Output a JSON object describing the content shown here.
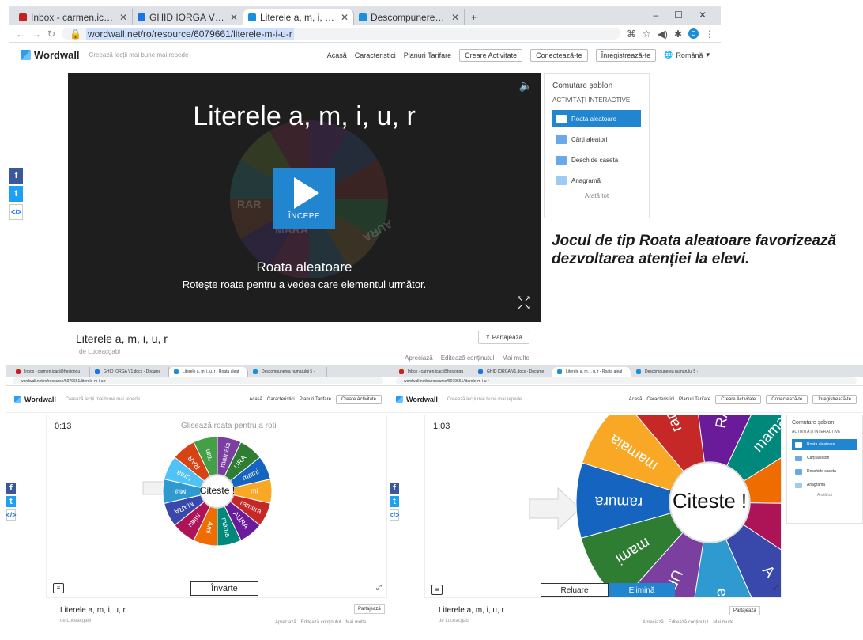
{
  "top": {
    "tabs": [
      {
        "title": "Inbox - carmen.icaci@hesiongu",
        "color": "#c5221f"
      },
      {
        "title": "GHID IORGA V1.docx - Docume",
        "color": "#1a73e8"
      },
      {
        "title": "Literele a, m, i, u, r - Roata aleat",
        "color": "#1a8fe0"
      },
      {
        "title": "Descompunerea numarului 5 - ",
        "color": "#1a8fe0"
      }
    ],
    "new_tab": "+",
    "url": "wordwall.net/ro/resource/6079661/literele-m-i-u-r",
    "logo": "Wordwall",
    "tagline": "Creează lecții mai bune mai repede",
    "nav": [
      "Acasă",
      "Caracteristici",
      "Planuri Tarifare"
    ],
    "btn_create": "Creare Activitate",
    "btn_login": "Conectează-te",
    "btn_register": "Înregistrează-te",
    "lang": "Română",
    "player": {
      "title": "Literele a, m, i, u, r",
      "start": "ÎNCEPE",
      "game_name": "Roata aleatoare",
      "game_desc": "Roteşte roata pentru a vedea care elementul următor.",
      "ghost_words": [
        "RAR",
        "MARA",
        "AURA"
      ]
    },
    "templates": {
      "title": "Comutare șablon",
      "subtitle": "ACTIVITĂȚI INTERACTIVE",
      "items": [
        "Roata aleatoare",
        "Cărți aleatori",
        "Deschide caseta",
        "Anagramă"
      ],
      "more": "Arată tot"
    },
    "info": {
      "title": "Literele a, m, i, u, r",
      "author": "de Luceacgabi",
      "share": "Partajează",
      "actions": [
        "Apreciază",
        "Editează conținutul",
        "Mai multe"
      ]
    }
  },
  "caption": "Jocul de tip Roata aleatoare favorizează dezvoltarea atenției la elevi.",
  "bottom_left": {
    "timer": "0:13",
    "hint": "Glisează roata pentru a roti",
    "center": "Citeste !",
    "words": [
      "mamaia",
      "URA",
      "mami",
      "mi",
      "ramura",
      "AURA",
      "mama",
      "Ami",
      "miau",
      "MARA",
      "Mia",
      "Uma",
      "RAR",
      "ram"
    ],
    "spin": "Învârte",
    "title": "Literele a, m, i, u, r",
    "author": "de Luceacgabi",
    "share": "Partajează",
    "actions": [
      "Apreciază",
      "Editează conținutul",
      "Mai multe"
    ]
  },
  "bottom_right": {
    "timer": "1:03",
    "center": "Citeste !",
    "visible_words": [
      "URA",
      "mami",
      "ramura",
      "mamaia",
      "ram",
      "RAR",
      "mama",
      "RA",
      "ra",
      "A",
      "e"
    ],
    "replay": "Reluare",
    "remove": "Elimină",
    "title": "Literele a, m, i, u, r",
    "author": "de Luceacgabi",
    "share": "Partajează",
    "actions": [
      "Apreciază",
      "Editează conținutul",
      "Mai multe"
    ],
    "templates": {
      "title": "Comutare șablon",
      "subtitle": "ACTIVITĂȚI INTERACTIVE",
      "items": [
        "Roata aleatoare",
        "Cărți aleatori",
        "Deschide caseta",
        "Anagramă"
      ],
      "more": "Arată tot"
    }
  },
  "colors": {
    "accent": "#2185d0",
    "wheel": [
      "#7b3fa0",
      "#2e7d32",
      "#1565c0",
      "#f9a825",
      "#c62828",
      "#6a1b9a",
      "#00897b",
      "#ef6c00",
      "#ad1457",
      "#3949ab",
      "#2e9ad0",
      "#4fc3f7",
      "#d84315",
      "#43a047"
    ]
  }
}
